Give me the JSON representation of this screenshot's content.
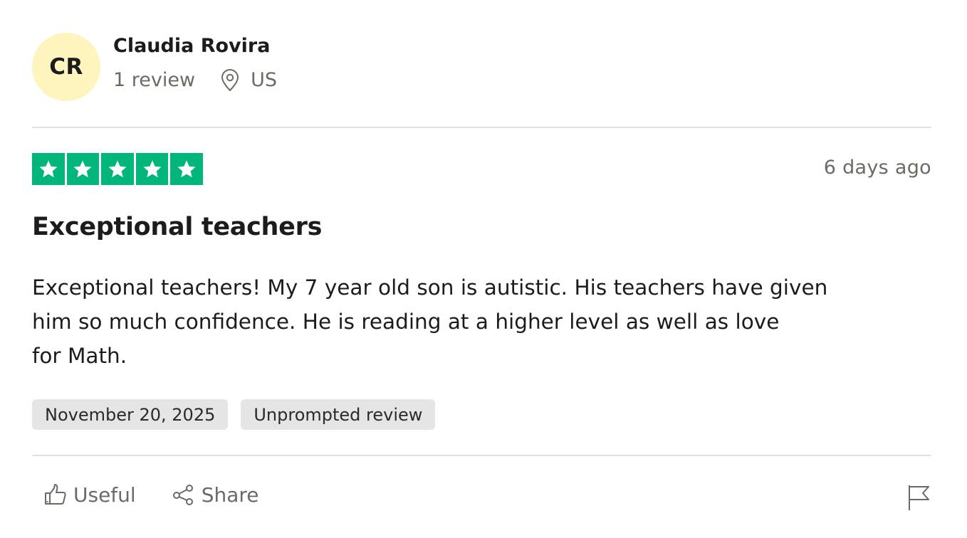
{
  "reviewer": {
    "initials": "CR",
    "name": "Claudia Rovira",
    "review_count": "1 review",
    "location": "US",
    "avatar_color": "#fdf4be"
  },
  "review": {
    "rating": 5,
    "max_rating": 5,
    "star_color": "#00b67a",
    "relative_date": "6 days ago",
    "title": "Exceptional teachers",
    "body": "Exceptional teachers! My 7 year old son is autistic. His teachers have given\nhim so much confidence. He is reading at a higher level as well as love\nfor Math.",
    "tags": {
      "date": "November 20, 2025",
      "type": "Unprompted review"
    }
  },
  "actions": {
    "useful_label": "Useful",
    "share_label": "Share",
    "icons": {
      "useful": "thumbs-up-icon",
      "share": "share-icon",
      "flag": "flag-icon",
      "location": "map-pin-icon",
      "star": "star-icon"
    }
  }
}
